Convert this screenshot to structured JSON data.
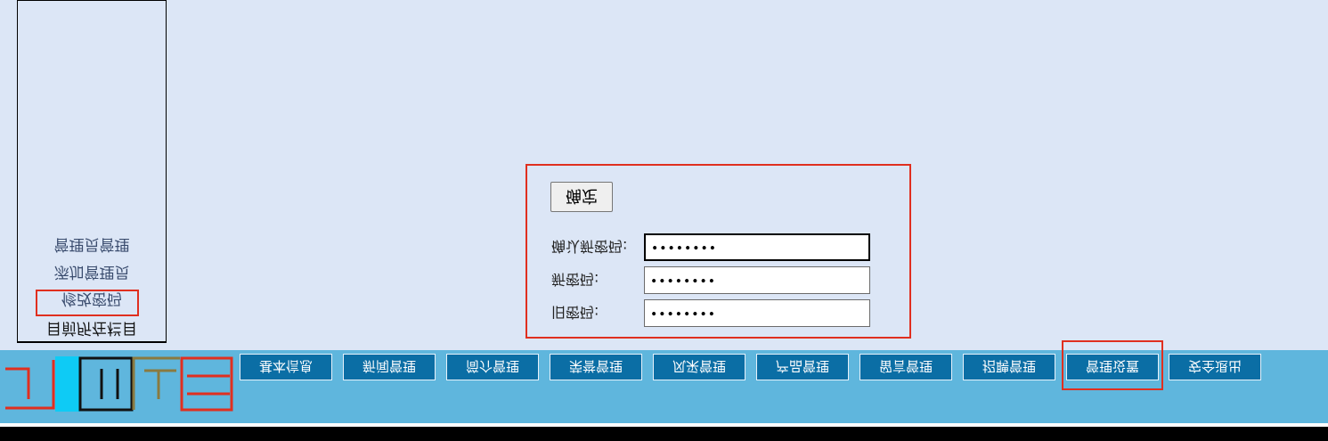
{
  "nav": {
    "items": [
      "基本信息",
      "新闻管理",
      "简介管理",
      "荣誉管理",
      "风采管理",
      "产品管理",
      "留言管理",
      "招聘管理",
      "管理设置",
      "安全退出"
    ],
    "selected_index": 8
  },
  "sidebar": {
    "title": "目前所在栏目",
    "items": [
      "修改密码",
      "添加管理员",
      "管理员管理"
    ],
    "active_index": 0
  },
  "form": {
    "old_password_label": "旧密码:",
    "old_password_value": "••••••••",
    "new_password_label": "新密码:",
    "new_password_value": "••••••••",
    "confirm_password_label": "确认新密码:",
    "confirm_password_value": "••••••••",
    "submit_label": "确定"
  }
}
